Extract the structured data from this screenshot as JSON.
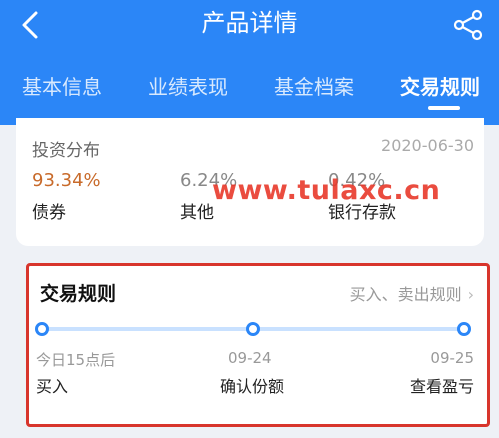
{
  "header": {
    "title": "产品详情"
  },
  "tabs": [
    {
      "label": "基本信息",
      "active": false
    },
    {
      "label": "业绩表现",
      "active": false
    },
    {
      "label": "基金档案",
      "active": false
    },
    {
      "label": "交易规则",
      "active": true
    }
  ],
  "distribution": {
    "label": "投资分布",
    "date": "2020-06-30",
    "items": [
      {
        "value": "93.34%",
        "name": "债券",
        "color": "#c86a2a"
      },
      {
        "value": "6.24%",
        "name": "其他",
        "color": "#888888"
      },
      {
        "value": "0.42%",
        "name": "银行存款",
        "color": "#888888"
      }
    ]
  },
  "watermark": "www.tulaxc.cn",
  "trade_rules": {
    "title": "交易规则",
    "rule_link": "买入、卖出规则",
    "steps": [
      {
        "date": "今日15点后",
        "name": "买入"
      },
      {
        "date": "09-24",
        "name": "确认份额"
      },
      {
        "date": "09-25",
        "name": "查看盈亏"
      }
    ]
  },
  "colors": {
    "brand": "#2b86f7",
    "highlight_frame": "#d8352c",
    "watermark": "#e8392b"
  }
}
